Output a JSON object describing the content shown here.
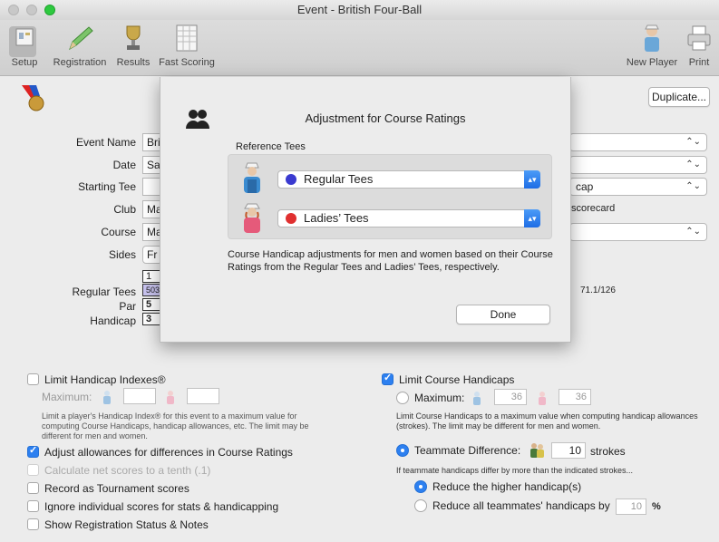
{
  "window": {
    "title": "Event - British Four-Ball"
  },
  "toolbar": {
    "setup": "Setup",
    "registration": "Registration",
    "results": "Results",
    "fast_scoring": "Fast Scoring",
    "new_player": "New Player",
    "print": "Print"
  },
  "form": {
    "duplicate_label": "Duplicate...",
    "event_name_label": "Event Name",
    "event_name_value": "Bri",
    "date_label": "Date",
    "date_value": "Sa",
    "starting_tee_label": "Starting Tee",
    "starting_tee_right": "cap",
    "club_label": "Club",
    "club_value": "Ma",
    "club_right": "scorecard",
    "course_label": "Course",
    "course_value": "Ma",
    "sides_label": "Sides",
    "sides_value": "Fr",
    "regular_tees_label": "Regular Tees",
    "par_label": "Par",
    "handicap_label": "Handicap",
    "hole_1": "1",
    "regular_1": "503",
    "par_1": "5",
    "handicap_1": "3",
    "rating": "71.1/126"
  },
  "left_options": {
    "limit_hi": "Limit Handicap Indexes®",
    "maximum": "Maximum:",
    "limit_hi_note": "Limit a player's Handicap Index® for this event to a maximum value for computing Course Handicaps, handicap allowances, etc. The limit may be different for men and women.",
    "adjust_allowances": "Adjust allowances for differences in Course Ratings",
    "net_tenth": "Calculate net scores to a tenth (.1)",
    "tournament": "Record as Tournament scores",
    "ignore_scores": "Ignore individual scores for stats & handicapping",
    "show_registration": "Show Registration Status & Notes"
  },
  "right_options": {
    "limit_ch": "Limit Course Handicaps",
    "maximum": "Maximum:",
    "max_men": "36",
    "max_women": "36",
    "limit_ch_note": "Limit Course Handicaps to a maximum value when computing handicap allowances (strokes). The limit may be different for men and women.",
    "teammate_diff": "Teammate Difference:",
    "teammate_value": "10",
    "strokes": "strokes",
    "teammate_note": "If teammate handicaps differ by more than the indicated strokes...",
    "reduce_higher": "Reduce the higher handicap(s)",
    "reduce_all": "Reduce all teammates' handicaps by",
    "reduce_all_value": "10",
    "percent": "%"
  },
  "sheet": {
    "title": "Adjustment for Course Ratings",
    "reference_tees": "Reference Tees",
    "men_tee": "Regular Tees",
    "women_tee": "Ladies’ Tees",
    "description": "Course Handicap adjustments for men and women based on their Course Ratings from the Regular Tees and Ladies’ Tees, respectively.",
    "done": "Done"
  },
  "colors": {
    "accent": "#2d80f0",
    "men_ball": "#3a3ad0",
    "women_ball": "#e03030",
    "grid_highlight": "#c9c4f0"
  }
}
